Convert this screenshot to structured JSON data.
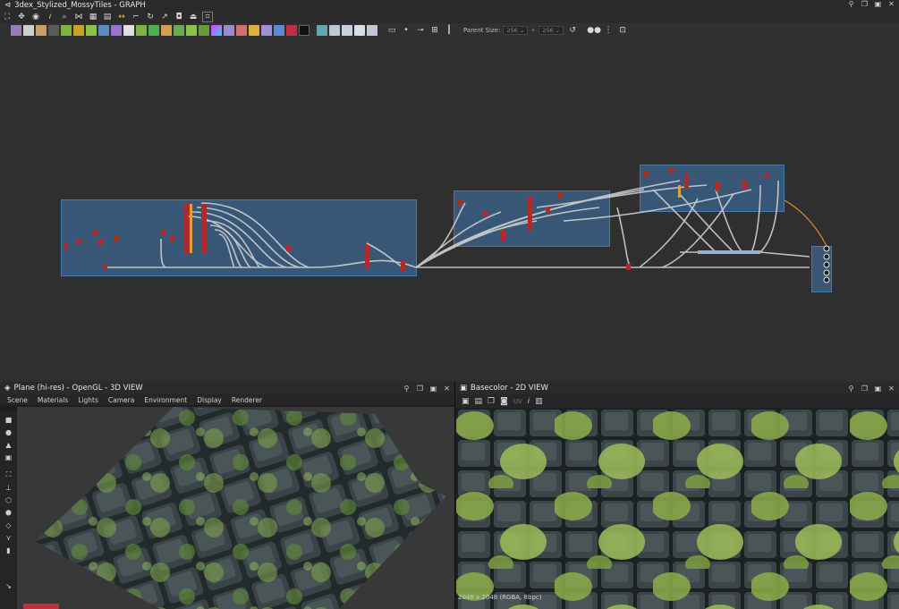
{
  "graph_panel": {
    "title": "3dex_Stylized_MossyTiles - GRAPH",
    "parent_size_label": "Parent Size:",
    "parent_size_w": "256",
    "parent_size_h": "256"
  },
  "view3d": {
    "title": "Plane (hi-res) - OpenGL - 3D VIEW",
    "menus": [
      "Scene",
      "Materials",
      "Lights",
      "Camera",
      "Environment",
      "Display",
      "Renderer"
    ]
  },
  "view2d": {
    "title": "Basecolor - 2D VIEW",
    "uv_label": "UV",
    "status": "2048 x 2048 (RGBA, 8bpc)"
  },
  "colors": {
    "frame_blue": "#3a6088",
    "node_red": "#b02a2a",
    "wire": "#cfcfcf",
    "accent_orange": "#d98a2a"
  },
  "icons": {
    "graph_toolbar": [
      "frame-icon",
      "move-icon",
      "camera-icon",
      "info-icon",
      "search-icon",
      "link-icon",
      "grid-icon",
      "node-icon",
      "align-icon",
      "curve-icon",
      "layout-icon",
      "publish-icon",
      "flask-icon",
      "frame-all-icon"
    ],
    "view2d_toolbar": [
      "view-icon",
      "save-icon",
      "copy-icon",
      "display-icon",
      "info-icon",
      "histogram-icon"
    ],
    "side_tools": [
      "camera-icon",
      "light-icon",
      "scene-icon",
      "viewport-icon",
      "fit-icon",
      "axes-icon",
      "cube-icon",
      "cube-outline-icon",
      "plane-icon",
      "tangent-icon",
      "stats-icon"
    ]
  }
}
